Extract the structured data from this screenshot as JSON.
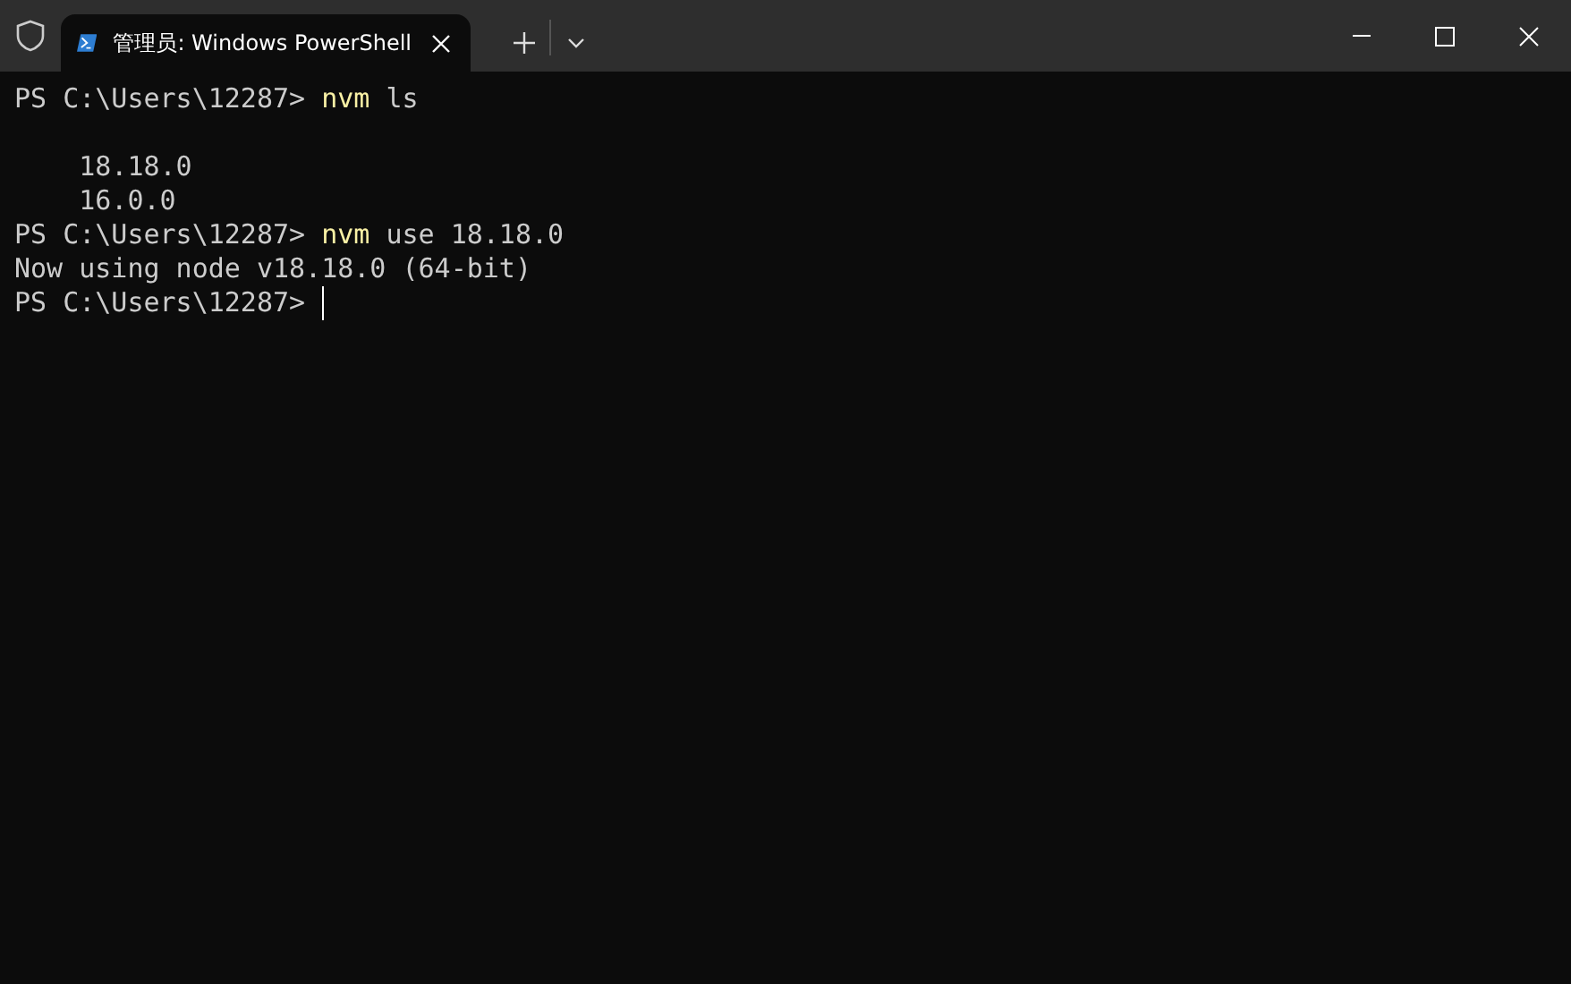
{
  "tab": {
    "title": "管理员: Windows PowerShell",
    "selected": true
  },
  "lines": [
    [
      {
        "kind": "plain",
        "text": "PS C:\\Users\\12287> "
      },
      {
        "kind": "command",
        "text": "nvm"
      },
      {
        "kind": "plain",
        "text": " ls"
      }
    ],
    [
      {
        "kind": "blank"
      }
    ],
    [
      {
        "kind": "plain",
        "text": "    18.18.0"
      }
    ],
    [
      {
        "kind": "plain",
        "text": "    16.0.0"
      }
    ],
    [
      {
        "kind": "plain",
        "text": "PS C:\\Users\\12287> "
      },
      {
        "kind": "command",
        "text": "nvm"
      },
      {
        "kind": "plain",
        "text": " use 18.18.0"
      }
    ],
    [
      {
        "kind": "plain",
        "text": "Now using node v18.18.0 (64-bit)"
      }
    ],
    [
      {
        "kind": "plain",
        "text": "PS C:\\Users\\12287> "
      },
      {
        "kind": "cursor"
      }
    ]
  ]
}
